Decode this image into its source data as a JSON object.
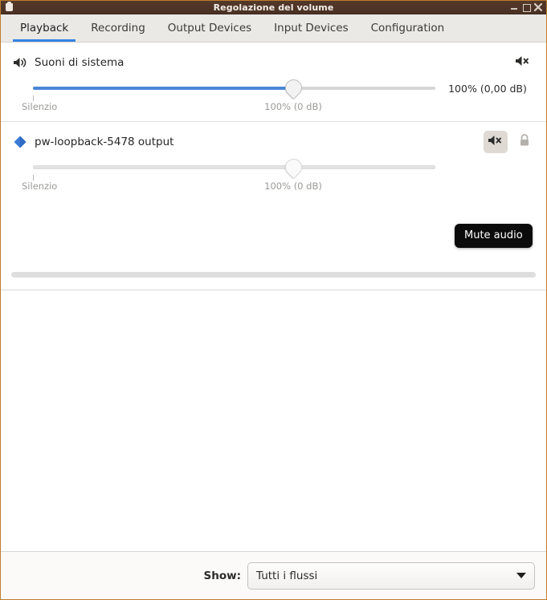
{
  "window": {
    "title": "Regolazione del volume",
    "icon": "app-icon",
    "controls": {
      "minimize": "minimize-icon",
      "maximize": "maximize-icon",
      "close": "close-icon"
    }
  },
  "tabs": [
    {
      "label": "Playback",
      "active": true
    },
    {
      "label": "Recording",
      "active": false
    },
    {
      "label": "Output Devices",
      "active": false
    },
    {
      "label": "Input Devices",
      "active": false
    },
    {
      "label": "Configuration",
      "active": false
    }
  ],
  "streams": [
    {
      "icon": "speaker-icon",
      "title": "Suoni di sistema",
      "mute_icon": "speaker-muted-icon",
      "locked": false,
      "slider": {
        "fill_percent": 62,
        "min_label": "Silenzio",
        "base_label": "100% (0 dB)",
        "base_percent": 62,
        "filled": true
      },
      "readout": "100% (0,00 dB)"
    },
    {
      "icon": "diamond-icon",
      "title": "pw-loopback-5478 output",
      "mute_icon": "speaker-muted-icon",
      "mute_hovered": true,
      "locked": true,
      "lock_icon": "lock-icon",
      "slider": {
        "fill_percent": 0,
        "min_label": "Silenzio",
        "base_label": "100% (0 dB)",
        "base_percent": 62,
        "filled": false
      },
      "readout": ""
    }
  ],
  "tooltip": {
    "text": "Mute audio"
  },
  "bottom": {
    "show_label": "Show:",
    "filter_value": "Tutti i flussi",
    "dropdown_icon": "chevron-down-icon"
  },
  "colors": {
    "accent": "#3584e4",
    "slider_fill": "#4a86d8",
    "titlebar": "#4b3225",
    "window_border": "#c07d2e",
    "tooltip_bg": "#0b0b0b"
  }
}
